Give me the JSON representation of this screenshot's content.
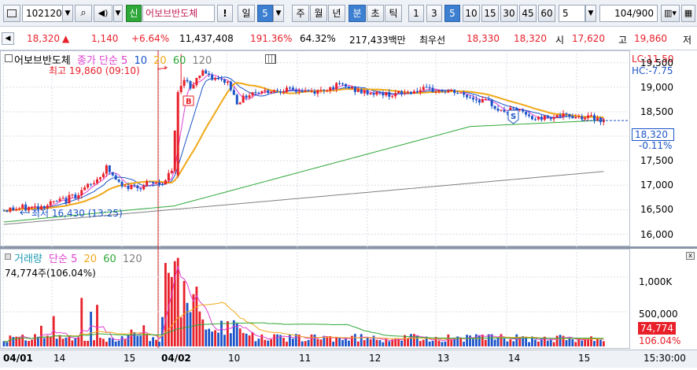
{
  "toolbar": {
    "stock_code": "102120",
    "market_badge": "신",
    "stock_name": "어보브반도체",
    "alert_icon": "!",
    "period_day": "일",
    "period_day_num": "5",
    "tab_week": "주",
    "tab_month": "월",
    "tab_year": "년",
    "tab_minute": "분",
    "tab_second": "초",
    "tab_tick": "틱",
    "interval_1": "1",
    "interval_3": "3",
    "interval_5": "5",
    "interval_10": "10",
    "interval_15": "15",
    "interval_30": "30",
    "interval_45": "45",
    "interval_60": "60",
    "interval_select": "5",
    "count_value": "104",
    "count_total": "/900"
  },
  "info": {
    "price": "18,320",
    "change_arrow": "▲",
    "change": "1,140",
    "change_pct": "+6.64%",
    "volume": "11,437,408",
    "volume_ratio": "191.36%",
    "turnover": "64.32%",
    "amount": "217,433백만",
    "best_bid_label": "최우선",
    "best_ask": "18,330",
    "best_bid": "18,320",
    "open_label": "시",
    "open": "17,620",
    "high_label": "고",
    "high": "19,860",
    "low_label": "저"
  },
  "price_panel": {
    "legend_name": "어보브반도체",
    "legend_ma_label": "종가 단순",
    "ma_periods": [
      "5",
      "10",
      "20",
      "60",
      "120"
    ],
    "lc_label": "LC:11.50",
    "hc_label": "HC:-7.75",
    "high_marker": "최고 19,860 (09:10)",
    "low_marker": "최저 16,430 (13:25)",
    "current_price": "18,320",
    "current_pct": "-0.11%",
    "y_ticks": [
      "19,500",
      "19,000",
      "18,500",
      "18,000",
      "17,500",
      "17,000",
      "16,500",
      "16,000"
    ]
  },
  "volume_panel": {
    "legend_name": "거래량",
    "legend_ma_label": "단순",
    "ma_periods": [
      "5",
      "20",
      "60",
      "120"
    ],
    "current_text": "74,774주(106.04%)",
    "current_value": "74,774",
    "current_pct": "106.04%",
    "y_ticks": [
      "1,000K",
      "500,000"
    ]
  },
  "x_axis": {
    "labels": [
      "04/01",
      "14",
      "15",
      "04/02",
      "10",
      "11",
      "12",
      "13",
      "14",
      "15"
    ],
    "end_time": "15:30:00"
  },
  "colors": {
    "up": "#e8202a",
    "down": "#1c54c8",
    "ma5": "#e040d0",
    "ma10": "#1c54c8",
    "ma20": "#f0a818",
    "ma60": "#2ea838",
    "ma120": "#808080",
    "grid": "#d8dde6"
  },
  "chart_data": {
    "type": "candlestick",
    "interval": "5min",
    "y_range": [
      15800,
      19720
    ],
    "high": 19860,
    "low": 16430,
    "last": 18320,
    "volume_last": 74774
  }
}
